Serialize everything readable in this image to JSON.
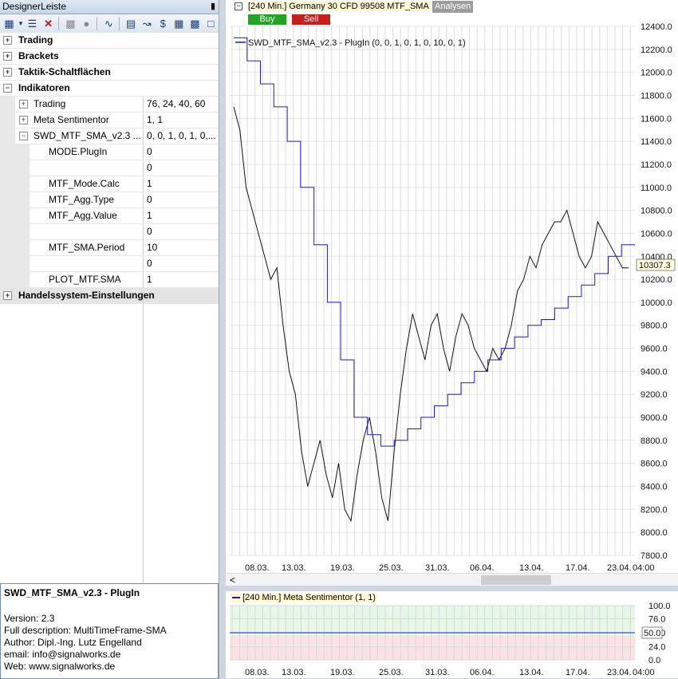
{
  "panel": {
    "title": "DesignerLeiste",
    "pin": "█",
    "toolbar_icons": [
      "grid-icon",
      "dropdown-icon",
      "list-icon",
      "delete-icon",
      "calculator-icon",
      "person-icon",
      "line-chart-icon",
      "printer-icon",
      "trend-icon",
      "dollar-icon",
      "data-grid-icon",
      "table-icon",
      "window-icon"
    ]
  },
  "tree": {
    "categories": [
      "Trading",
      "Brackets",
      "Taktik-Schaltflächen",
      "Indikatoren",
      "Handelssystem-Einstellungen"
    ],
    "sub_trading": {
      "label": "Trading",
      "value": "76, 24, 40, 60"
    },
    "sub_meta": {
      "label": "Meta Sentimentor",
      "value": "1, 1"
    },
    "sub_swd": {
      "label": "SWD_MTF_SMA_v2.3 ...",
      "value": "0, 0, 1, 0, 1, 0,..."
    },
    "params": [
      {
        "label": "MODE.PlugIn",
        "value": "0"
      },
      {
        "label": "",
        "value": "0"
      },
      {
        "label": "MTF_Mode.Calc",
        "value": "1"
      },
      {
        "label": "MTF_Agg.Type",
        "value": "0"
      },
      {
        "label": "MTF_Agg.Value",
        "value": "1"
      },
      {
        "label": "",
        "value": "0"
      },
      {
        "label": "MTF_SMA.Period",
        "value": "10"
      },
      {
        "label": "",
        "value": "0"
      },
      {
        "label": "PLOT_MTF.SMA",
        "value": "1"
      }
    ]
  },
  "description": {
    "title": "SWD_MTF_SMA_v2.3 - PlugIn",
    "version": "Version: 2.3",
    "full": "Full description: MultiTimeFrame-SMA",
    "author": "Author: Dipl.-Ing. Lutz Engelland",
    "email": "email: info@signalworks.de",
    "web": "Web: www.signalworks.de"
  },
  "chart": {
    "instrument": "[240 Min.] Germany 30 CFD   99508 MTF_SMA",
    "analysen": "Analysen",
    "buy": "Buy",
    "sell": "Sell",
    "legend": "SWD_MTF_SMA_v2.3 - PlugIn  (0, 0, 1, 0, 1, 0, 10, 0, 1)",
    "current_price": "10307.3",
    "sub_title": "[240 Min.] Meta Sentimentor  (1, 1)",
    "sub_value": "50.0",
    "scroll_left": "<"
  },
  "chart_data": {
    "type": "line",
    "y_ticks": [
      "12400.0",
      "12200.0",
      "12000.0",
      "11800.0",
      "11600.0",
      "11400.0",
      "11200.0",
      "11000.0",
      "10800.0",
      "10600.0",
      "10400.0",
      "10200.0",
      "10000.0",
      "9800.0",
      "9600.0",
      "9400.0",
      "9200.0",
      "9000.0",
      "8800.0",
      "8600.0",
      "8400.0",
      "8200.0",
      "8000.0",
      "7800.0"
    ],
    "ylim": [
      7800,
      12400
    ],
    "x_ticks": [
      "08.03.",
      "13.03.",
      "19.03.",
      "25.03.",
      "31.03.",
      "06.04.",
      "13.04.",
      "17.04.",
      "23.04.",
      "04:00"
    ],
    "price_path": [
      11700,
      11500,
      11000,
      10800,
      10600,
      10400,
      10200,
      10300,
      9800,
      9400,
      9200,
      8700,
      8400,
      8600,
      8800,
      8500,
      8300,
      8600,
      8200,
      8100,
      8500,
      8800,
      9000,
      8700,
      8300,
      8100,
      8700,
      9200,
      9600,
      9900,
      9700,
      9500,
      9800,
      9900,
      9600,
      9400,
      9700,
      9900,
      9800,
      9600,
      9500,
      9400,
      9600,
      9500,
      9600,
      9800,
      10100,
      10200,
      10400,
      10300,
      10500,
      10600,
      10700,
      10700,
      10800,
      10600,
      10400,
      10300,
      10400,
      10700,
      10600,
      10500,
      10400,
      10300,
      10300
    ],
    "sma_path": [
      12300,
      12100,
      11900,
      11700,
      11400,
      11000,
      10500,
      10000,
      9500,
      9000,
      8850,
      8750,
      8800,
      8900,
      9000,
      9100,
      9200,
      9300,
      9400,
      9500,
      9600,
      9700,
      9800,
      9850,
      9950,
      10050,
      10150,
      10250,
      10400,
      10500,
      10500
    ],
    "sub_y_ticks": [
      "100.0",
      "76.0",
      "50.0",
      "24.0",
      "0.0"
    ],
    "sub_series": {
      "value": 50
    }
  }
}
